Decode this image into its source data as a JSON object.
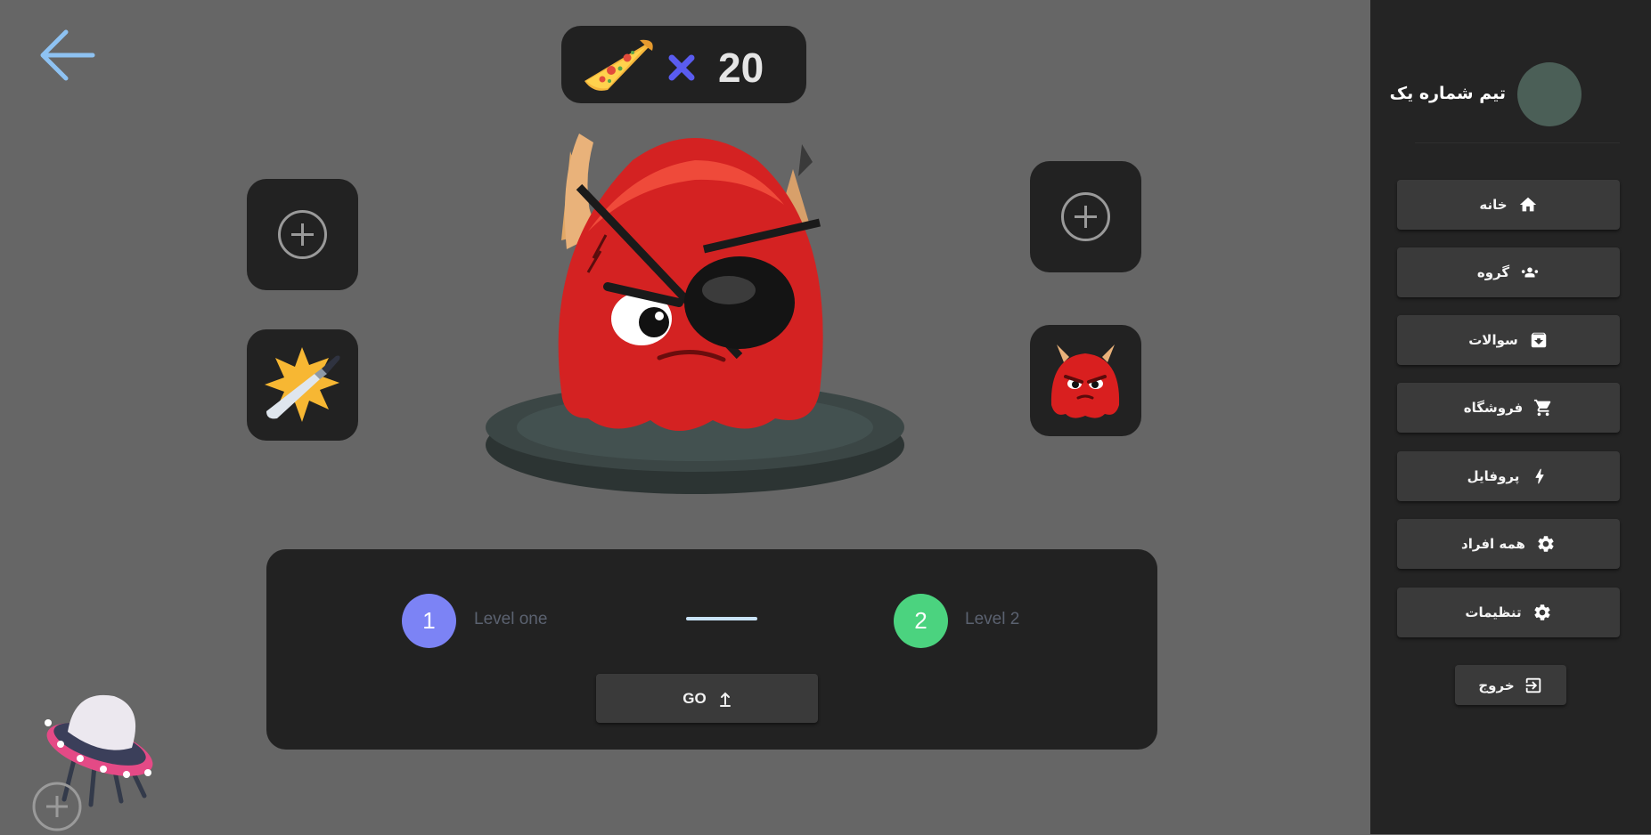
{
  "resources": {
    "item_icon": "pizza-icon",
    "multiplier_symbol": "x-icon",
    "count": "20"
  },
  "slots": {
    "left_top": {
      "state": "empty",
      "icon": "plus-circle-icon"
    },
    "left_bottom": {
      "state": "filled",
      "icon": "knife-icon"
    },
    "right_top": {
      "state": "empty",
      "icon": "plus-circle-icon"
    },
    "right_bottom": {
      "state": "filled",
      "icon": "red-monster-icon"
    }
  },
  "character": {
    "icon": "red-pirate-monster"
  },
  "levels": {
    "current": {
      "number": "1",
      "label": "Level one",
      "color": "#7c83f5"
    },
    "next": {
      "number": "2",
      "label": "Level 2",
      "color": "#4bd37f"
    },
    "go_label": "GO"
  },
  "sidebar": {
    "team_name": "تیم شماره یک",
    "items": [
      {
        "label": "خانه",
        "icon": "home-icon"
      },
      {
        "label": "گروه",
        "icon": "group-icon"
      },
      {
        "label": "سوالات",
        "icon": "archive-icon"
      },
      {
        "label": "فروشگاه",
        "icon": "cart-icon"
      },
      {
        "label": "پروفایل",
        "icon": "bolt-icon"
      },
      {
        "label": "همه افراد",
        "icon": "gear-icon"
      },
      {
        "label": "تنظیمات",
        "icon": "gear-icon"
      }
    ],
    "exit_label": "خروج"
  },
  "colors": {
    "sidebar_bg": "#242424",
    "main_bg": "#666666",
    "panel_bg": "#222222",
    "back_arrow": "#8ec2f2"
  }
}
